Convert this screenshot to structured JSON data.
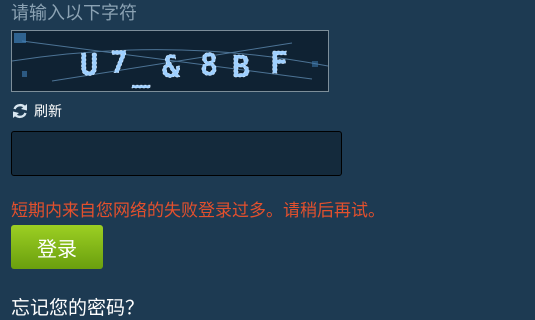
{
  "captcha": {
    "prompt": "请输入以下字符",
    "characters": [
      "U",
      "7",
      "_",
      "&",
      "8",
      "B",
      "F"
    ]
  },
  "refresh": {
    "label": "刷新",
    "icon": "refresh-icon"
  },
  "code_input": {
    "value": "",
    "placeholder": ""
  },
  "error_message": "短期内来自您网络的失败登录过多。请稍后再试。",
  "login_button": {
    "label": "登录"
  },
  "forgot_password": "忘记您的密码？",
  "colors": {
    "background": "#1d3a52",
    "error": "#e3502d",
    "button": "#7eb41a",
    "captcha_glyph": "#9fd0ff"
  }
}
